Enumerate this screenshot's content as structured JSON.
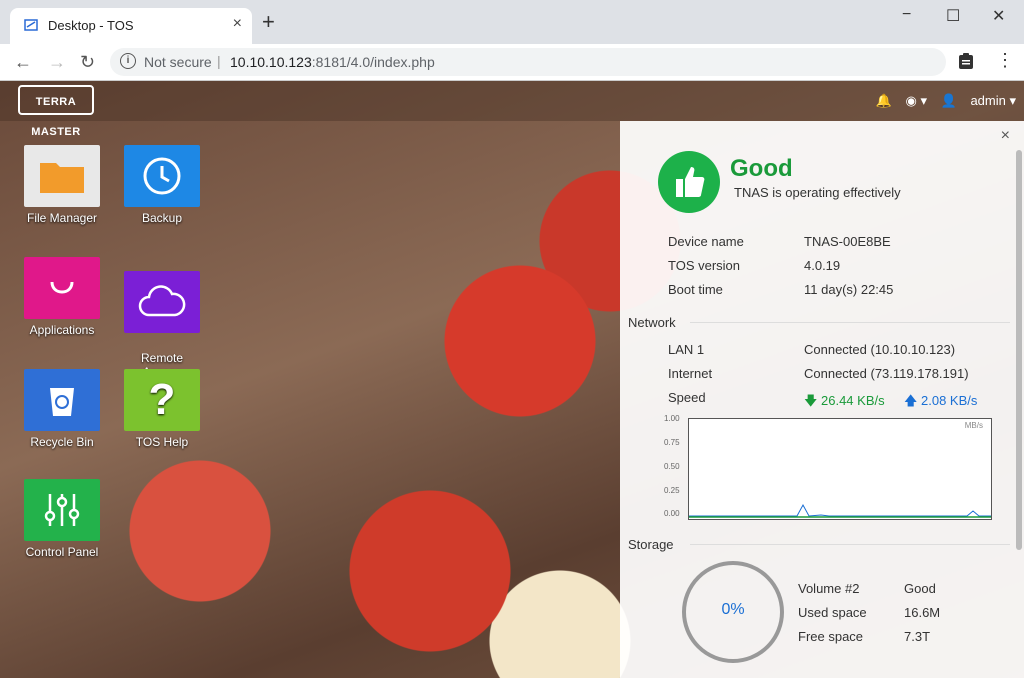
{
  "browser": {
    "tab_title": "Desktop - TOS",
    "tab_close": "×",
    "new_tab": "+",
    "security_text": "Not secure",
    "separator": "|",
    "url_host": "10.10.10.123",
    "url_rest": ":8181/4.0/index.php",
    "window_controls": [
      "−",
      "☐",
      "✕"
    ],
    "nav": [
      "←",
      "→",
      "↻"
    ]
  },
  "desktop": {
    "logo": "TERRA MASTER",
    "user": "admin",
    "apps": [
      {
        "label": "File Manager",
        "color": "#e8e8e8",
        "icon": "folder-icon"
      },
      {
        "label": "Backup",
        "color": "#1e88e5",
        "icon": "clock-icon"
      },
      {
        "label": "Applications",
        "color": "#e0188a",
        "icon": "bag-icon"
      },
      {
        "label": "Remote\nAccess",
        "color": "#7b1fd6",
        "icon": "cloud-icon"
      },
      {
        "label": "Recycle Bin",
        "color": "#2f6fd6",
        "icon": "recycle-icon"
      },
      {
        "label": "TOS Help",
        "color": "#7cc22e",
        "icon": "help-icon"
      },
      {
        "label": "Control Panel",
        "color": "#23b24b",
        "icon": "sliders-icon"
      }
    ]
  },
  "panel": {
    "status_title": "Good",
    "status_sub": "TNAS is operating effectively",
    "status_color": "#1db14a",
    "close": "×",
    "device": [
      {
        "label": "Device name",
        "value": "TNAS-00E8BE"
      },
      {
        "label": "TOS version",
        "value": "4.0.19"
      },
      {
        "label": "Boot time",
        "value": "11 day(s) 22:45"
      }
    ],
    "network_title": "Network",
    "network": [
      {
        "label": "LAN 1",
        "value": "Connected (10.10.10.123)"
      },
      {
        "label": "Internet",
        "value": "Connected (73.119.178.191)"
      }
    ],
    "speed_label": "Speed",
    "download": "26.44 KB/s",
    "upload": "2.08 KB/s",
    "chart_unit": "MB/s",
    "chart_ticks": [
      "1.00",
      "0.75",
      "0.50",
      "0.25",
      "0.00"
    ],
    "storage_title": "Storage",
    "gauge_value": "0%",
    "storage": [
      {
        "label": "Volume #2",
        "value": "Good"
      },
      {
        "label": "Used space",
        "value": "16.6M"
      },
      {
        "label": "Free space",
        "value": "7.3T"
      }
    ]
  }
}
